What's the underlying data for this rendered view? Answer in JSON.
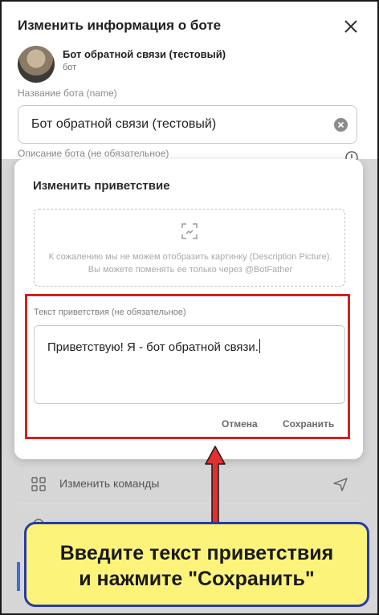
{
  "panel": {
    "title": "Изменить информация о боте",
    "bot_name": "Бот обратной связи (тестовый)",
    "bot_type": "бот",
    "name_label": "Название бота (name)",
    "name_value": "Бот обратной связи (тестовый)",
    "description_label": "Описание бота (не обязательное)"
  },
  "list": {
    "items": [
      {
        "label": "Изменить команды",
        "icon": "grid-icon"
      }
    ]
  },
  "modal": {
    "title": "Изменить приветствие",
    "picture_notice": "К сожалению мы не можем отобразить картинку (Description Picture). Вы можете поменять ее только через @BotFather",
    "greeting_label": "Текст приветствия (не обязательное)",
    "greeting_value": "Приветствую! Я - бот обратной связи.",
    "cancel_label": "Отмена",
    "save_label": "Сохранить"
  },
  "annotation": {
    "line1": "Введите текст приветствия",
    "line2": "и нажмите \"Сохранить\""
  },
  "colors": {
    "highlight": "#d22121",
    "callout_bg": "#fbf37a",
    "callout_border": "#2a3aa8",
    "accent": "#3d6fd6"
  }
}
